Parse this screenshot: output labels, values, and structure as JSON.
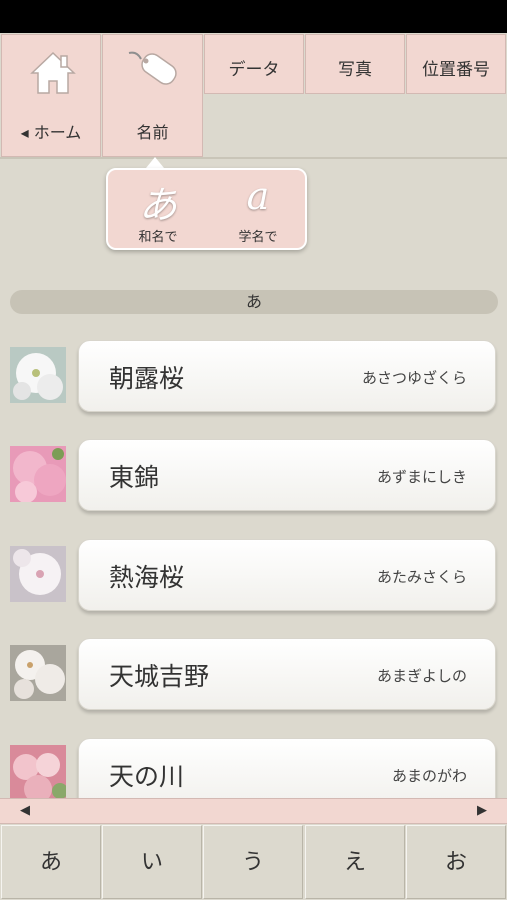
{
  "nav": {
    "home_label": "◂ ホーム",
    "name_label": "名前",
    "tabs": [
      "データ",
      "写真",
      "位置番号"
    ]
  },
  "popup": {
    "japanese": {
      "glyph": "あ",
      "caption": "和名で"
    },
    "scientific": {
      "glyph": "a",
      "caption": "学名で"
    }
  },
  "section_header": "あ",
  "items": [
    {
      "name": "朝露桜",
      "reading": "あさつゆざくら",
      "thumb": "white"
    },
    {
      "name": "東錦",
      "reading": "あずまにしき",
      "thumb": "pink"
    },
    {
      "name": "熱海桜",
      "reading": "あたみさくら",
      "thumb": "white"
    },
    {
      "name": "天城吉野",
      "reading": "あまぎよしの",
      "thumb": "white"
    },
    {
      "name": "天の川",
      "reading": "あまのがわ",
      "thumb": "pink"
    }
  ],
  "kana_buttons": [
    "あ",
    "い",
    "う",
    "え",
    "お"
  ],
  "colors": {
    "accent_pink": "#f2d7d1",
    "background": "#dcd9ce"
  }
}
